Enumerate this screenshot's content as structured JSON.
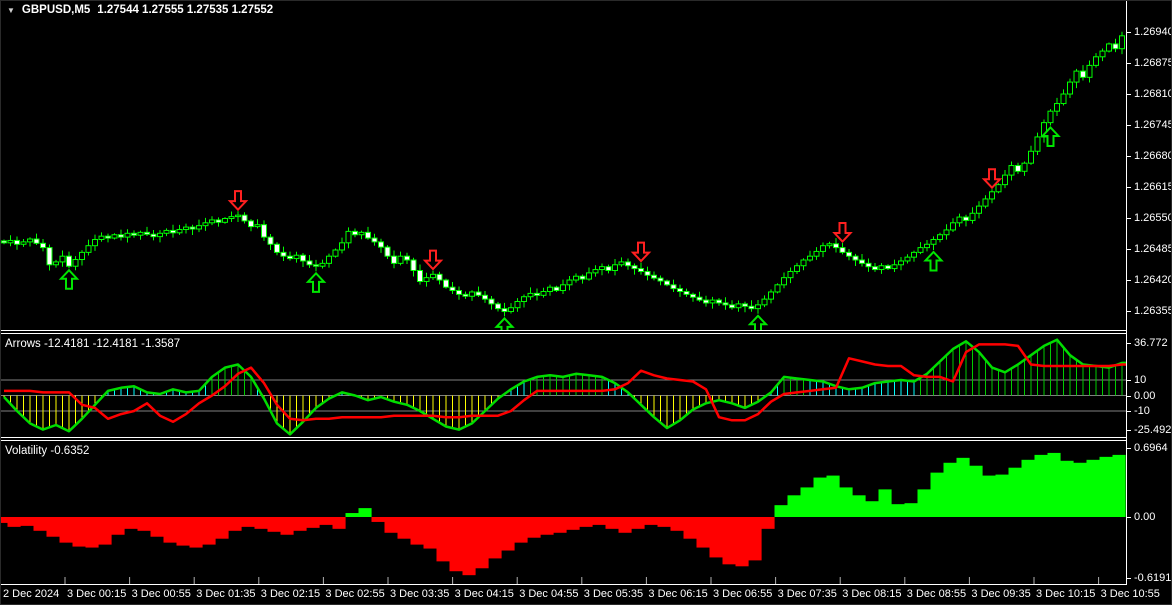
{
  "window": {
    "menu_icon": "▼",
    "symbol_period": "GBPUSD,M5",
    "quotes": "1.27544 1.27555 1.27535 1.27552"
  },
  "colors": {
    "background": "#000000",
    "candle_outline": "#00FF00",
    "bull_fill": "#000000",
    "bear_fill": "#FFFFFF",
    "up_arrow": "#00E600",
    "down_arrow": "#FF2020",
    "arrows_green_line": "#00DD00",
    "arrows_red_line": "#FF0000",
    "hist_above10": "#00CC00",
    "hist_0_10": "#00FFFF",
    "hist_below0": "#FFFF00",
    "vol_up": "#00FF00",
    "vol_down": "#FF0000",
    "grid": "#808080",
    "frame": "#FFFFFF",
    "text": "#FFFFFF"
  },
  "main_chart": {
    "type": "candlestick",
    "base_price": 1.26,
    "price_axis_labels": [
      "1.26940",
      "1.26875",
      "1.26810",
      "1.26745",
      "1.26680",
      "1.26615",
      "1.26550",
      "1.26485",
      "1.26420",
      "1.26355"
    ],
    "price_axis_values": [
      1.2694,
      1.26875,
      1.2681,
      1.26745,
      1.2668,
      1.26615,
      1.2655,
      1.26485,
      1.2642,
      1.26355
    ],
    "closes_points": [
      498,
      503,
      495,
      500,
      506,
      497,
      488,
      452,
      458,
      470,
      449,
      463,
      478,
      492,
      505,
      512,
      508,
      515,
      510,
      518,
      514,
      520,
      516,
      511,
      518,
      524,
      519,
      526,
      531,
      527,
      534,
      540,
      546,
      541,
      549,
      553,
      556,
      544,
      532,
      536,
      510,
      495,
      478,
      470,
      465,
      472,
      460,
      452,
      449,
      455,
      470,
      483,
      498,
      522,
      515,
      520,
      508,
      500,
      489,
      470,
      455,
      470,
      462,
      440,
      417,
      425,
      432,
      420,
      405,
      398,
      390,
      386,
      395,
      388,
      380,
      370,
      360,
      354,
      362,
      375,
      385,
      392,
      388,
      396,
      405,
      398,
      410,
      420,
      428,
      422,
      435,
      442,
      448,
      440,
      452,
      458,
      450,
      444,
      438,
      430,
      424,
      418,
      410,
      402,
      396,
      390,
      384,
      378,
      372,
      378,
      372,
      368,
      362,
      370,
      365,
      360,
      368,
      380,
      395,
      410,
      425,
      438,
      450,
      462,
      470,
      480,
      492,
      496,
      488,
      478,
      470,
      462,
      455,
      448,
      442,
      450,
      444,
      452,
      460,
      468,
      478,
      488,
      495,
      505,
      515,
      525,
      540,
      552,
      545,
      560,
      575,
      590,
      605,
      620,
      640,
      660,
      648,
      665,
      690,
      720,
      750,
      774,
      790,
      810,
      835,
      858,
      845,
      870,
      888,
      900,
      915,
      905,
      932
    ],
    "signals": {
      "up_bars": [
        10,
        48,
        77,
        116,
        143,
        161
      ],
      "down_bars": [
        36,
        66,
        98,
        129,
        152
      ]
    }
  },
  "arrows_panel": {
    "label": "Arrows -12.4181 -12.4181 -1.3587",
    "axis_labels": [
      "36.772",
      "10",
      "0.00",
      "-10",
      "-25.4921"
    ],
    "axis_values": [
      36.772,
      10,
      0,
      -10,
      -25.4921
    ],
    "gridline_values": [
      10,
      0,
      -10
    ],
    "green_series": [
      -1,
      -10,
      -18,
      -22,
      -19,
      -23,
      -15,
      -6,
      3,
      5,
      6,
      2,
      1,
      4,
      2,
      3,
      12,
      18,
      20,
      12,
      -2,
      -18,
      -25,
      -17,
      -8,
      -2,
      2,
      0,
      -3,
      -1,
      -4,
      -6,
      -10,
      -15,
      -20,
      -22,
      -18,
      -10,
      -2,
      4,
      9,
      12,
      13,
      12,
      14,
      13,
      12,
      8,
      2,
      -6,
      -14,
      -21,
      -16,
      -9,
      -5,
      -3,
      -5,
      -8,
      -4,
      2,
      12,
      11,
      10,
      9,
      6,
      4,
      5,
      8,
      9,
      10,
      9,
      14,
      22,
      30,
      35,
      28,
      18,
      15,
      20,
      26,
      32,
      36,
      26,
      20,
      19,
      18,
      21
    ],
    "red_series": [
      3,
      3,
      3,
      2,
      2,
      2,
      -6,
      -8,
      -15,
      -12,
      -10,
      -5,
      -13,
      -17,
      -12,
      -5,
      0,
      6,
      14,
      18,
      8,
      -6,
      -15,
      -16,
      -15,
      -15,
      -14,
      -14,
      -14,
      -14,
      -13,
      -13,
      -13,
      -13,
      -14,
      -14,
      -13,
      -13,
      -13,
      -10,
      -3,
      3,
      3,
      3,
      3,
      3,
      3,
      4,
      8,
      16,
      13,
      11,
      10,
      9,
      4,
      -14,
      -16,
      -16,
      -12,
      -4,
      1,
      2,
      3,
      4,
      5,
      24,
      22,
      20,
      19,
      19,
      13,
      12,
      12,
      9,
      28,
      33,
      33,
      33,
      32,
      20,
      19,
      19,
      19,
      19,
      19,
      19,
      20
    ]
  },
  "volatility_panel": {
    "label": "Volatility -0.6352",
    "axis_labels": [
      "0.6964",
      "0.00",
      "-0.6191"
    ],
    "axis_values": [
      0.6964,
      0,
      -0.6191
    ],
    "values": [
      -0.06,
      -0.1,
      -0.09,
      -0.14,
      -0.2,
      -0.26,
      -0.3,
      -0.31,
      -0.28,
      -0.18,
      -0.12,
      -0.14,
      -0.2,
      -0.26,
      -0.29,
      -0.31,
      -0.28,
      -0.22,
      -0.14,
      -0.1,
      -0.12,
      -0.15,
      -0.18,
      -0.14,
      -0.11,
      -0.08,
      -0.12,
      0.04,
      0.09,
      -0.05,
      -0.16,
      -0.22,
      -0.28,
      -0.32,
      -0.45,
      -0.55,
      -0.59,
      -0.52,
      -0.42,
      -0.34,
      -0.26,
      -0.21,
      -0.18,
      -0.16,
      -0.13,
      -0.1,
      -0.08,
      -0.12,
      -0.16,
      -0.12,
      -0.08,
      -0.1,
      -0.14,
      -0.22,
      -0.31,
      -0.41,
      -0.48,
      -0.5,
      -0.44,
      -0.12,
      0.12,
      0.22,
      0.3,
      0.4,
      0.42,
      0.3,
      0.22,
      0.16,
      0.28,
      0.13,
      0.14,
      0.28,
      0.45,
      0.55,
      0.6,
      0.52,
      0.42,
      0.43,
      0.5,
      0.58,
      0.63,
      0.65,
      0.57,
      0.55,
      0.58,
      0.61,
      0.63
    ]
  },
  "time_axis": {
    "labels": [
      "2 Dec 2024",
      "3 Dec 00:15",
      "3 Dec 00:55",
      "3 Dec 01:35",
      "3 Dec 02:15",
      "3 Dec 02:55",
      "3 Dec 03:35",
      "3 Dec 04:15",
      "3 Dec 04:55",
      "3 Dec 05:35",
      "3 Dec 06:15",
      "3 Dec 06:55",
      "3 Dec 07:35",
      "3 Dec 08:15",
      "3 Dec 08:55",
      "3 Dec 09:35",
      "3 Dec 10:15",
      "3 Dec 10:55"
    ]
  }
}
